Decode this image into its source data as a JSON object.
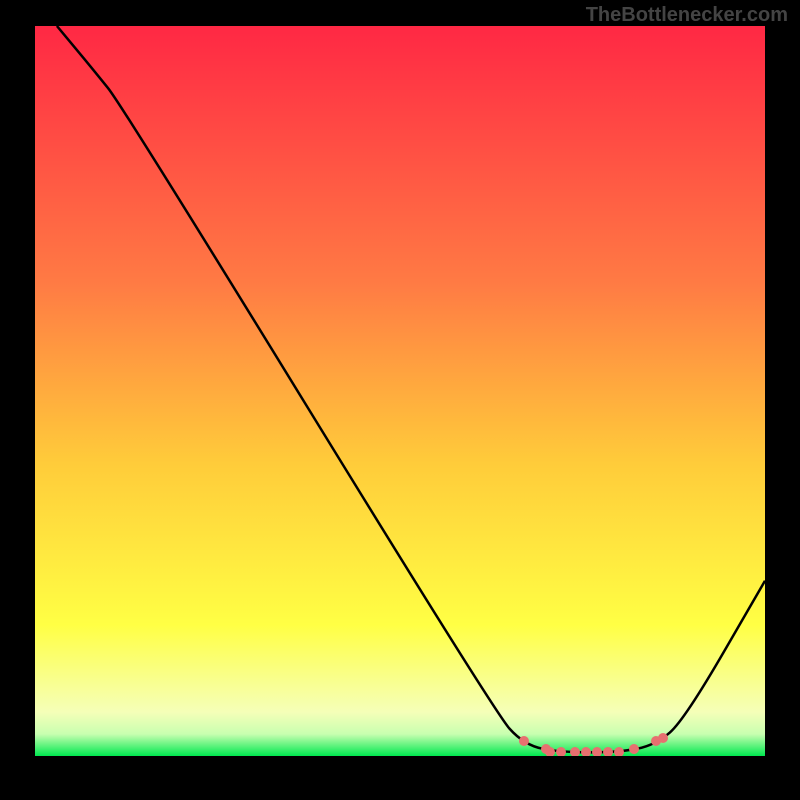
{
  "header": {
    "source": "TheBottlenecker.com"
  },
  "chart_data": {
    "type": "line",
    "title": "",
    "xlabel": "",
    "ylabel": "",
    "xlim": [
      0,
      100
    ],
    "ylim": [
      0,
      100
    ],
    "gradient_stops": [
      {
        "offset": 0,
        "color": "#ff2844"
      },
      {
        "offset": 35,
        "color": "#ff7a44"
      },
      {
        "offset": 60,
        "color": "#ffcc3a"
      },
      {
        "offset": 82,
        "color": "#ffff44"
      },
      {
        "offset": 94,
        "color": "#f5ffb8"
      },
      {
        "offset": 97,
        "color": "#c8ffb0"
      },
      {
        "offset": 100,
        "color": "#00e850"
      }
    ],
    "curve": [
      {
        "x": 3,
        "y": 100
      },
      {
        "x": 8,
        "y": 94
      },
      {
        "x": 12,
        "y": 89
      },
      {
        "x": 63,
        "y": 6
      },
      {
        "x": 67,
        "y": 1.5
      },
      {
        "x": 72,
        "y": 0.5
      },
      {
        "x": 80,
        "y": 0.5
      },
      {
        "x": 85,
        "y": 1.5
      },
      {
        "x": 89,
        "y": 5
      },
      {
        "x": 100,
        "y": 24
      }
    ],
    "highlight_dots": [
      {
        "x": 67,
        "y": 2
      },
      {
        "x": 70,
        "y": 1
      },
      {
        "x": 70.5,
        "y": 0.5
      },
      {
        "x": 72,
        "y": 0.5
      },
      {
        "x": 74,
        "y": 0.5
      },
      {
        "x": 75.5,
        "y": 0.5
      },
      {
        "x": 77,
        "y": 0.5
      },
      {
        "x": 78.5,
        "y": 0.5
      },
      {
        "x": 80,
        "y": 0.5
      },
      {
        "x": 82,
        "y": 1
      },
      {
        "x": 85,
        "y": 2
      },
      {
        "x": 86,
        "y": 2.5
      }
    ]
  }
}
